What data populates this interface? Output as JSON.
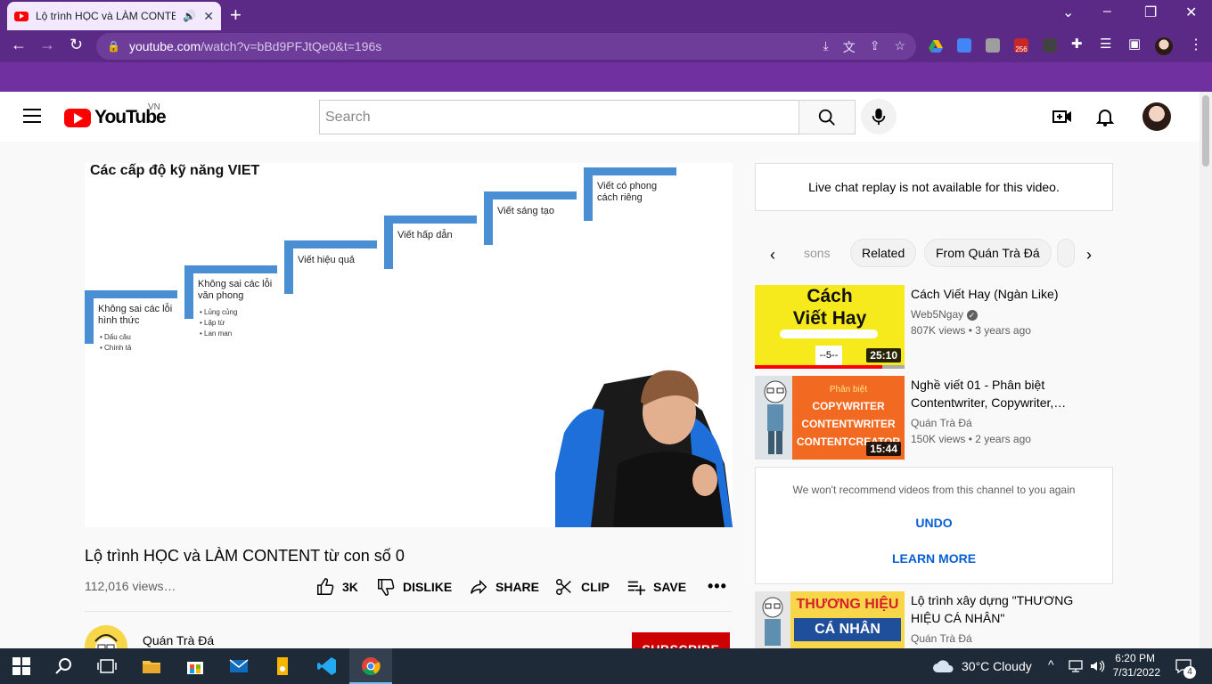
{
  "browser": {
    "tab_title": "Lộ trình HỌC và LÀM CONTENT",
    "tab_audio": "🔊",
    "url_host": "youtube.com",
    "url_path": "/watch?v=bBd9PFJtQe0&t=196s",
    "ext_badge": "256"
  },
  "header": {
    "logo_text": "YouTube",
    "country": "VN",
    "search_placeholder": "Search"
  },
  "video": {
    "slide_title": "Các cấp độ kỹ năng VIET",
    "steps": [
      {
        "label": "Không sai các lỗi hình thức",
        "subs": [
          "• Dấu câu",
          "• Chính tả"
        ]
      },
      {
        "label": "Không sai các lỗi văn phong",
        "subs": [
          "• Lủng củng",
          "• Lặp từ",
          "• Lan man"
        ]
      },
      {
        "label": "Viết hiệu quả"
      },
      {
        "label": "Viết hấp dẫn"
      },
      {
        "label": "Viết sáng tạo"
      },
      {
        "label": "Viết có phong cách riêng"
      }
    ],
    "title": "Lộ trình HỌC và LÀM CONTENT từ con số 0",
    "views": "112,016 views…",
    "actions": {
      "like": "3K",
      "dislike": "DISLIKE",
      "share": "SHARE",
      "clip": "CLIP",
      "save": "SAVE",
      "more": "•••"
    },
    "channel_name": "Quán Trà Đá",
    "subscribe": "SUBSCRIBE"
  },
  "sidebar": {
    "chat_notice": "Live chat replay is not available for this video.",
    "chips": [
      "sons",
      "Related",
      "From Quán Trà Đá"
    ],
    "recs": [
      {
        "title": "Cách Viết Hay (Ngàn Like)",
        "channel": "Web5Ngay",
        "meta": "807K views • 3 years ago",
        "duration": "25:10",
        "thumb_line1": "Cách",
        "thumb_line2": "Viết Hay",
        "thumb_small": "--5--"
      },
      {
        "title": "Nghề viết 01 - Phân biệt Contentwriter, Copywriter,…",
        "channel": "Quán Trà Đá",
        "meta": "150K views • 2 years ago",
        "duration": "15:44",
        "thumb_line0": "Phân biệt",
        "thumb_line1": "COPYWRITER",
        "thumb_line2": "CONTENTWRITER",
        "thumb_line3": "CONTENTCREATOR"
      },
      {
        "title": "Lộ trình xây dựng \"THƯƠNG HIỆU CÁ NHÂN\"",
        "channel": "Quán Trà Đá",
        "thumb_line1": "THƯƠNG HIỆU",
        "thumb_line2": "CÁ NHÂN"
      }
    ],
    "feedback": {
      "text": "We won't recommend videos from this channel to you again",
      "undo": "UNDO",
      "learn_more": "LEARN MORE"
    }
  },
  "taskbar": {
    "weather": "30°C  Cloudy",
    "time": "6:20 PM",
    "date": "7/31/2022",
    "notifications": "4"
  }
}
